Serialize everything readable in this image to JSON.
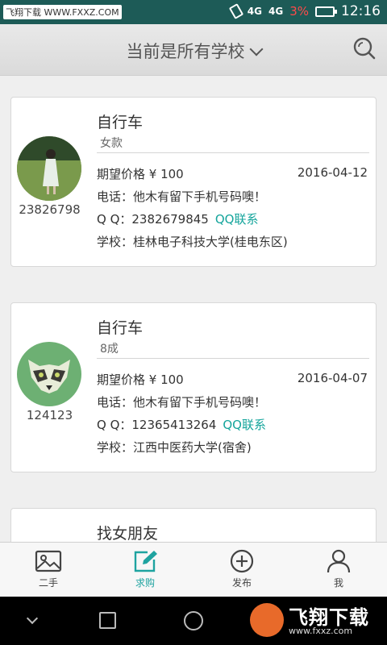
{
  "status_bar": {
    "watermark": "飞翔下载 WWW.FXXZ.COM",
    "network_1": "4G",
    "network_2": "4G",
    "battery_pct": "3%",
    "time": "12:16"
  },
  "header": {
    "title": "当前是所有学校",
    "search_icon": "search-icon",
    "dropdown_icon": "chevron-down-icon"
  },
  "cards": [
    {
      "title": "自行车",
      "subtitle": "女款",
      "uid": "23826798",
      "price": "期望价格 ¥ 100",
      "date": "2016-04-12",
      "phone": "电话：他木有留下手机号码噢！",
      "qq_prefix": "Q Q：",
      "qq": "2382679845",
      "qq_link": "QQ联系",
      "school": "学校：桂林电子科技大学(桂电东区)"
    },
    {
      "title": "自行车",
      "subtitle": "8成",
      "uid": "124123",
      "price": "期望价格 ¥ 100",
      "date": "2016-04-07",
      "phone": "电话：他木有留下手机号码噢！",
      "qq_prefix": "Q Q：",
      "qq": "12365413264",
      "qq_link": "QQ联系",
      "school": "学校：江西中医药大学(宿舍)"
    },
    {
      "title": "找女朋友"
    }
  ],
  "tabbar": {
    "items": [
      {
        "label": "二手",
        "icon": "image-icon"
      },
      {
        "label": "求购",
        "icon": "edit-icon"
      },
      {
        "label": "发布",
        "icon": "plus-circle-icon"
      },
      {
        "label": "我",
        "icon": "person-icon"
      }
    ],
    "active_color": "#1ea3a0"
  },
  "system_nav": {
    "brand_main": "飞翔下载",
    "brand_url": "www.fxxz.com"
  }
}
